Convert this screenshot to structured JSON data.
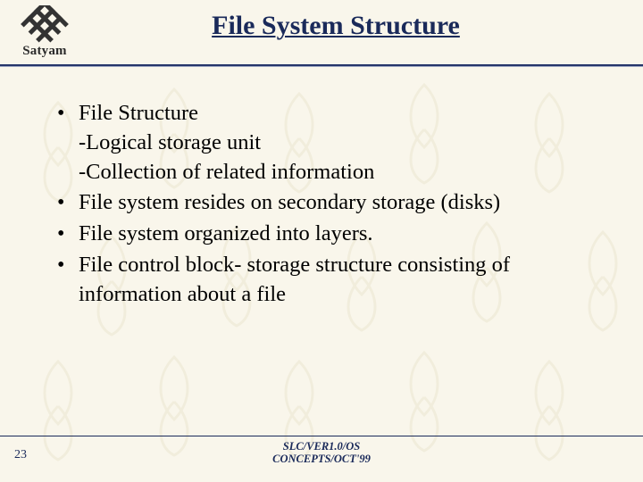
{
  "logo": {
    "text": "Satyam"
  },
  "title": "File System Structure",
  "bullets": [
    {
      "text": "File Structure",
      "subs": [
        "-Logical storage unit",
        "-Collection of related information"
      ]
    },
    {
      "text": "File system resides on secondary storage (disks)"
    },
    {
      "text": "File system organized into layers."
    },
    {
      "text": "File control block- storage structure consisting of information about a file"
    }
  ],
  "footer": {
    "page": "23",
    "line1": "SLC/VER1.0/OS",
    "line2": "CONCEPTS/OCT'99"
  }
}
